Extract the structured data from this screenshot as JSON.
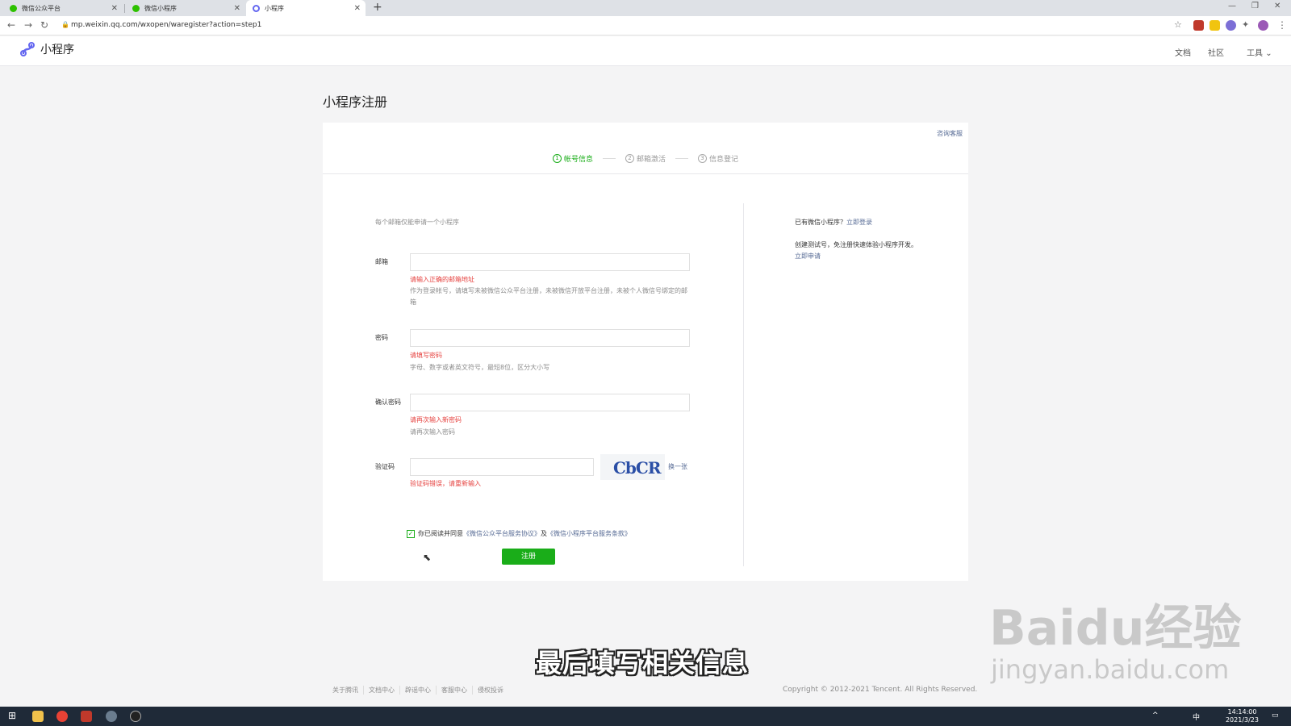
{
  "browser": {
    "tabs": [
      {
        "title": "微信公众平台",
        "active": false
      },
      {
        "title": "微信小程序",
        "active": false
      },
      {
        "title": "小程序",
        "active": true
      }
    ],
    "url": "mp.weixin.qq.com/wxopen/waregister?action=step1"
  },
  "header": {
    "logo_text": "小程序",
    "links": [
      "文档",
      "社区",
      "工具"
    ]
  },
  "page": {
    "title": "小程序注册",
    "help_link": "咨询客服",
    "steps": [
      {
        "num": "1",
        "label": "帐号信息",
        "active": true
      },
      {
        "num": "2",
        "label": "邮箱激活",
        "active": false
      },
      {
        "num": "3",
        "label": "信息登记",
        "active": false
      }
    ]
  },
  "form": {
    "note": "每个邮箱仅能申请一个小程序",
    "email": {
      "label": "邮箱",
      "error": "请输入正确的邮箱地址",
      "tip": "作为登录帐号，请填写未被微信公众平台注册，未被微信开放平台注册，未被个人微信号绑定的邮箱"
    },
    "password": {
      "label": "密码",
      "error": "请填写密码",
      "tip": "字母、数字或者英文符号，最短8位，区分大小写"
    },
    "confirm": {
      "label": "确认密码",
      "error": "请再次输入新密码",
      "tip": "请再次输入密码"
    },
    "captcha": {
      "label": "验证码",
      "image_text": "CbCR",
      "refresh": "换一张",
      "error": "验证码错误，请重新输入"
    },
    "agree_prefix": "你已阅读并同意",
    "agreement1": "《微信公众平台服务协议》",
    "agree_and": "及",
    "agreement2": "《微信小程序平台服务条款》",
    "submit": "注册"
  },
  "sidebar": {
    "login_prefix": "已有微信小程序？",
    "login_link": "立即登录",
    "test_text": "创建测试号，免注册快速体验小程序开发。",
    "test_link": "立即申请"
  },
  "footer": {
    "links": [
      "关于腾讯",
      "文档中心",
      "辟谣中心",
      "客服中心",
      "侵权投诉"
    ],
    "copyright": "Copyright © 2012-2021 Tencent. All Rights Reserved."
  },
  "overlay": {
    "subtitle": "最后填写相关信息",
    "watermark_main": "Baidu经验",
    "watermark_sub": "jingyan.baidu.com"
  },
  "taskbar": {
    "time": "14:14:00",
    "date": "2021/3/23",
    "ime": "中"
  },
  "colors": {
    "accent": "#1aad19",
    "error": "#e64340",
    "link": "#576b95"
  }
}
